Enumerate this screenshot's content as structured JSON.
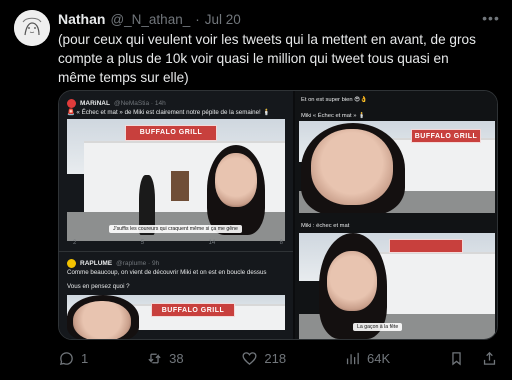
{
  "tweet": {
    "name": "Nathan",
    "handle": "@_N_athan_",
    "separator": "·",
    "date": "Jul 20",
    "text": "(pour ceux qui veulent voir les tweets qui la mettent en avant, de gros compte a plus de 10k voir quasi le million qui tweet tous quasi en même temps sur elle)",
    "more_icon": "more-horizontal-icon"
  },
  "media": {
    "quote_1": {
      "name": "MARiNAL",
      "handle": "@NeMaStia · 14h",
      "text": "🚨 « Échec et mat » de Miki est clairement notre pépite de la semaine! 🕯️",
      "caption": "J'suffis les coureurs qui craquent même si ça me gêne",
      "actions": [
        "2",
        "5",
        "14",
        "8"
      ]
    },
    "quote_2": {
      "name": "RAPLUME",
      "handle": "@raplume · 9h",
      "text_1": "Comme beaucoup, on vient de découvrir Miki et on est en boucle dessus",
      "text_2": "Vous en pensez quoi ?"
    },
    "right_top": {
      "text_1": "Et on est super bien 😎👌",
      "text_2": "Miki « Échec et mat » 🕯️"
    },
    "right_bottom": {
      "text": "Miki : échec et mat",
      "caption": "La gaçon à la fête"
    },
    "signs": [
      "BUFFALO GRILL",
      "BUFFALO GRILL",
      "BUFFALO GRILL"
    ]
  },
  "actions": {
    "replies": "1",
    "retweets": "38",
    "likes": "218",
    "views": "64K"
  }
}
